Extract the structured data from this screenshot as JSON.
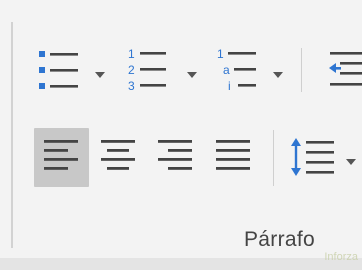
{
  "ribbon": {
    "group_label": "Párrafo",
    "list_buttons": [
      {
        "name": "bullets-button",
        "icon": "bullet-list-icon",
        "has_dropdown": true
      },
      {
        "name": "numbering-button",
        "icon": "numbered-list-icon",
        "numerals": [
          "1",
          "2",
          "3"
        ],
        "has_dropdown": true
      },
      {
        "name": "multilevel-list-button",
        "icon": "multilevel-list-icon",
        "markers": [
          "1",
          "a",
          "i"
        ],
        "has_dropdown": true
      },
      {
        "name": "decrease-indent-button",
        "icon": "decrease-indent-icon",
        "has_dropdown": false
      }
    ],
    "alignment_buttons": [
      {
        "name": "align-left-button",
        "icon": "align-left-icon",
        "selected": true
      },
      {
        "name": "center-button",
        "icon": "align-center-icon",
        "selected": false
      },
      {
        "name": "align-right-button",
        "icon": "align-right-icon",
        "selected": false
      },
      {
        "name": "justify-button",
        "icon": "justify-icon",
        "selected": false
      }
    ],
    "line_spacing_button": {
      "name": "line-spacing-button",
      "icon": "line-spacing-icon",
      "has_dropdown": true
    }
  },
  "colors": {
    "icon_dark": "#444444",
    "accent_blue": "#2e75d1",
    "selected_bg": "#c8c8c8"
  },
  "watermark": "Inforza"
}
